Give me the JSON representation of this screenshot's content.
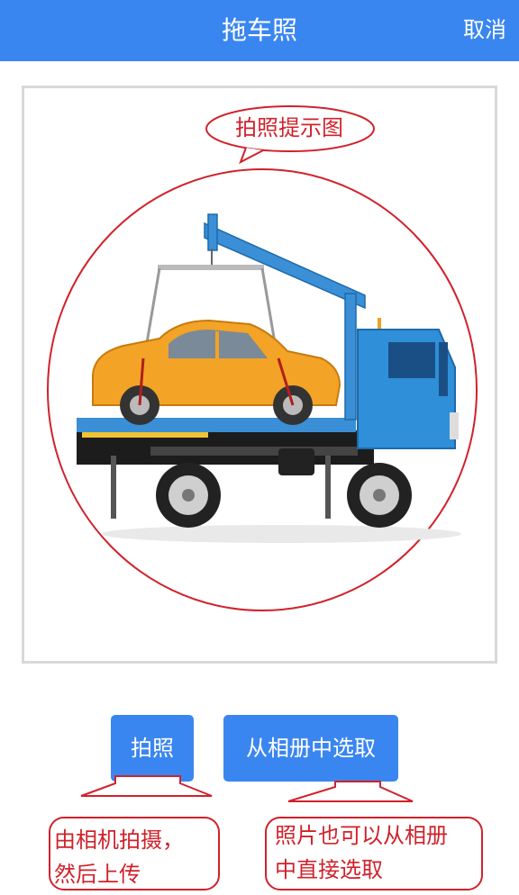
{
  "header": {
    "title": "拖车照",
    "cancel_label": "取消"
  },
  "preview": {
    "hint_label": "拍照提示图",
    "image_subject": "tow-truck-carrying-orange-car"
  },
  "actions": {
    "take_photo_label": "拍照",
    "choose_from_album_label": "从相册中选取"
  },
  "annotations": {
    "camera_note_line1": "由相机拍摄，",
    "camera_note_line2": "然后上传",
    "album_note_line1": "照片也可以从相册",
    "album_note_line2": "中直接选取"
  },
  "colors": {
    "primary": "#3a86f0",
    "annotation_red": "#d0222b",
    "car_orange": "#f3a326",
    "truck_blue": "#2f8fd8"
  }
}
